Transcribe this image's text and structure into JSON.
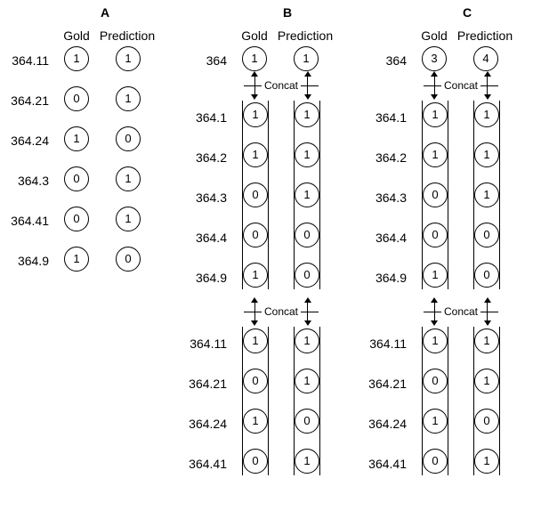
{
  "common": {
    "gold": "Gold",
    "prediction": "Prediction",
    "concat": "Concat"
  },
  "panels": {
    "A": {
      "label": "A",
      "rows": [
        "364.11",
        "364.21",
        "364.24",
        "364.3",
        "364.41",
        "364.9"
      ],
      "gold": [
        "1",
        "0",
        "1",
        "0",
        "0",
        "1"
      ],
      "pred": [
        "1",
        "1",
        "0",
        "1",
        "1",
        "0"
      ]
    },
    "B": {
      "label": "B",
      "tiers": [
        {
          "rows": [
            "364"
          ],
          "gold": [
            "1"
          ],
          "pred": [
            "1"
          ],
          "grouped": false
        },
        {
          "rows": [
            "364.1",
            "364.2",
            "364.3",
            "364.4",
            "364.9"
          ],
          "gold": [
            "1",
            "1",
            "0",
            "0",
            "1"
          ],
          "pred": [
            "1",
            "1",
            "1",
            "0",
            "0"
          ],
          "grouped": true
        },
        {
          "rows": [
            "364.11",
            "364.21",
            "364.24",
            "364.41"
          ],
          "gold": [
            "1",
            "0",
            "1",
            "0"
          ],
          "pred": [
            "1",
            "1",
            "0",
            "1"
          ],
          "grouped": true
        }
      ]
    },
    "C": {
      "label": "C",
      "tiers": [
        {
          "rows": [
            "364"
          ],
          "gold": [
            "3"
          ],
          "pred": [
            "4"
          ],
          "grouped": false
        },
        {
          "rows": [
            "364.1",
            "364.2",
            "364.3",
            "364.4",
            "364.9"
          ],
          "gold": [
            "1",
            "1",
            "0",
            "0",
            "1"
          ],
          "pred": [
            "1",
            "1",
            "1",
            "0",
            "0"
          ],
          "grouped": true
        },
        {
          "rows": [
            "364.11",
            "364.21",
            "364.24",
            "364.41"
          ],
          "gold": [
            "1",
            "0",
            "1",
            "0"
          ],
          "pred": [
            "1",
            "1",
            "0",
            "1"
          ],
          "grouped": true
        }
      ]
    }
  }
}
